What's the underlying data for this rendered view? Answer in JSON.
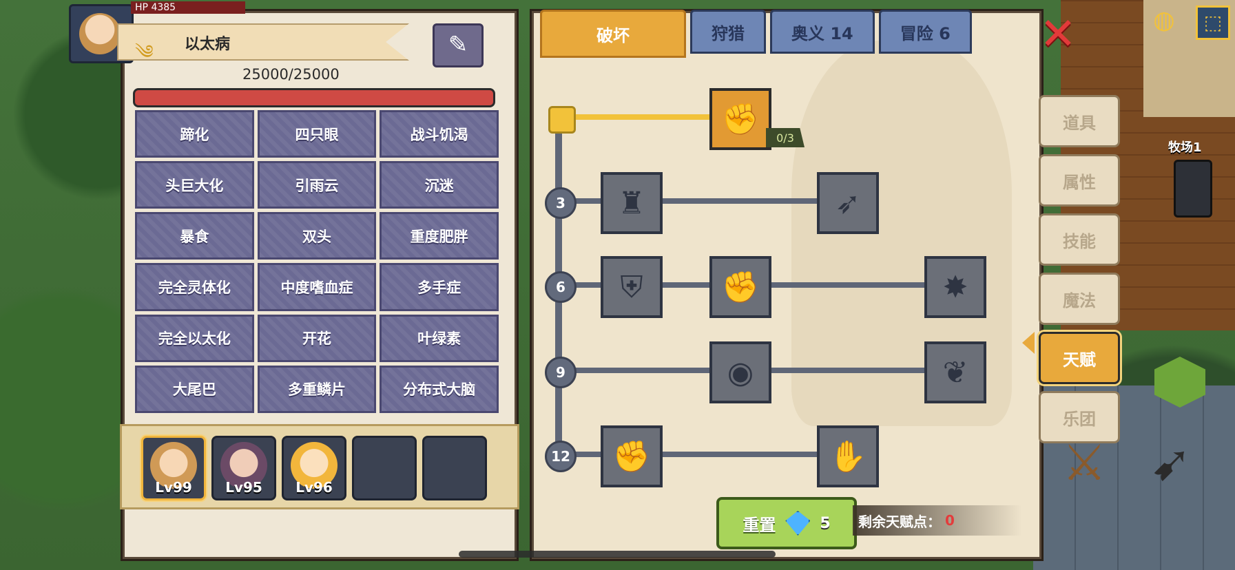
{
  "disease": {
    "icon": "wind-icon",
    "name": "以太病",
    "hp_value": "25000/25000",
    "hp_fraction": 1.0
  },
  "traits": [
    [
      "蹄化",
      "四只眼",
      "战斗饥渴"
    ],
    [
      "头巨大化",
      "引雨云",
      "沉迷"
    ],
    [
      "暴食",
      "双头",
      "重度肥胖"
    ],
    [
      "完全灵体化",
      "中度嗜血症",
      "多手症"
    ],
    [
      "完全以太化",
      "开花",
      "叶绿素"
    ],
    [
      "大尾巴",
      "多重鳞片",
      "分布式大脑"
    ]
  ],
  "team": [
    {
      "level": "Lv99",
      "selected": true
    },
    {
      "level": "Lv95",
      "selected": false
    },
    {
      "level": "Lv96",
      "selected": false
    },
    {
      "level": "",
      "selected": false
    },
    {
      "level": "",
      "selected": false
    }
  ],
  "tabs": {
    "destroy": "破坏",
    "hunt": "狩猎",
    "mystery": "奥义 14",
    "adventure": "冒险 6"
  },
  "tree": {
    "levels": [
      "3",
      "6",
      "9",
      "12"
    ],
    "first_skill_progress": "0/3"
  },
  "reset": {
    "label": "重置",
    "cost": "5"
  },
  "remaining": {
    "label": "剩余天赋点：",
    "value": "0"
  },
  "side_menu": {
    "items": [
      "道具",
      "属性",
      "技能",
      "魔法",
      "天赋",
      "乐团"
    ],
    "active": "天赋"
  },
  "world": {
    "ranch_label": "牧场1",
    "hp_label": "HP",
    "hp_number": "4385"
  },
  "colors": {
    "accent": "#e8a93c",
    "trait_bg": "#6b6a94",
    "hp_bar": "#cf4a44",
    "reset_green": "#a8d45a",
    "remaining_red": "#e33c3c"
  }
}
